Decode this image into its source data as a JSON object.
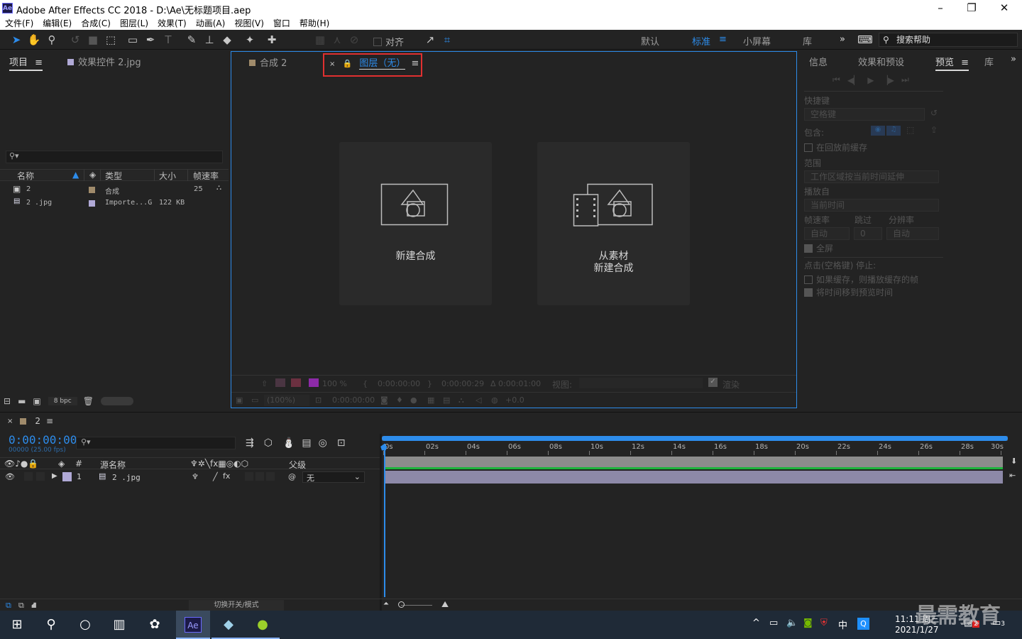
{
  "titlebar": {
    "title": "Adobe After Effects CC 2018 - D:\\Ae\\无标题项目.aep",
    "logo": "Ae",
    "minimize": "–",
    "maximize": "❐",
    "close": "✕"
  },
  "menu": [
    "文件(F)",
    "编辑(E)",
    "合成(C)",
    "图层(L)",
    "效果(T)",
    "动画(A)",
    "视图(V)",
    "窗口",
    "帮助(H)"
  ],
  "toolbar": {
    "align_label": "对齐",
    "workspaces": [
      "默认",
      "标准",
      "小屏幕",
      "库"
    ],
    "active_workspace": "标准",
    "overflow": "»",
    "search_help": "搜索帮助"
  },
  "project_panel": {
    "tabs": [
      "项目",
      "效果控件 2.jpg"
    ],
    "columns": [
      "名称",
      "类型",
      "大小",
      "帧速率"
    ],
    "items": [
      {
        "name": "2",
        "type": "合成",
        "size": "",
        "fps": "25"
      },
      {
        "name": "2 .jpg",
        "type": "Importe...G",
        "size": "122 KB",
        "fps": ""
      }
    ],
    "bpc": "8 bpc"
  },
  "viewer": {
    "tabs": [
      "合成 2",
      "图层（无）"
    ],
    "close_glyph": "×",
    "card_new_comp": "新建合成",
    "card_from_footage_line1": "从素材",
    "card_from_footage_line2": "新建合成",
    "bottom_zoom": "100 %",
    "time_start": "0:00:00:00",
    "time_end": "0:00:00:29",
    "time_dur": "Δ 0:00:01:00",
    "view_label": "视图:",
    "render_label": "渲染",
    "zoom_pct": "(100%)",
    "cur_time": "0:00:00:00",
    "offset": "+0.0"
  },
  "right_panel": {
    "tabs": [
      "信息",
      "效果和预设",
      "预览",
      "库"
    ],
    "active_tab": "预览",
    "overflow": "»",
    "shortcut_label": "快捷键",
    "shortcut_value": "空格键",
    "include_label": "包含:",
    "cache_before": "在回放前缓存",
    "range_label": "范围",
    "range_value": "工作区域按当前时间延伸",
    "play_from_label": "播放自",
    "play_from_value": "当前时间",
    "fps_label": "帧速率",
    "skip_label": "跳过",
    "res_label": "分辨率",
    "fps_value": "自动",
    "skip_value": "0",
    "res_value": "自动",
    "fullscreen": "全屏",
    "stop_label": "点击(空格键) 停止:",
    "opt1": "如果缓存，则播放缓存的帧",
    "opt2": "将时间移到预览时间"
  },
  "timeline": {
    "tab_close": "×",
    "comp_name": "2",
    "timecode": "0:00:00:00",
    "timecode_sub": "00000 (25.00 fps)",
    "col_source": "源名称",
    "col_parent": "父级",
    "col_num": "#",
    "layer_num": "1",
    "layer_name": "2 .jpg",
    "layer_parent": "无",
    "ticks": [
      "0s",
      "02s",
      "04s",
      "06s",
      "08s",
      "10s",
      "12s",
      "14s",
      "16s",
      "18s",
      "20s",
      "22s",
      "24s",
      "26s",
      "28s",
      "30s"
    ],
    "switch_mode": "切换开关/模式"
  },
  "taskbar": {
    "time": "11:11 周三",
    "date": "2021/1/27",
    "ime": "中",
    "notif_count": "2",
    "action_count": "3",
    "watermark": "最需教育"
  },
  "colors": {
    "accent": "#2d8ceb",
    "highlight_box": "#e03030",
    "layer_bar": "#8d89a8",
    "work_area": "#1db43c"
  }
}
